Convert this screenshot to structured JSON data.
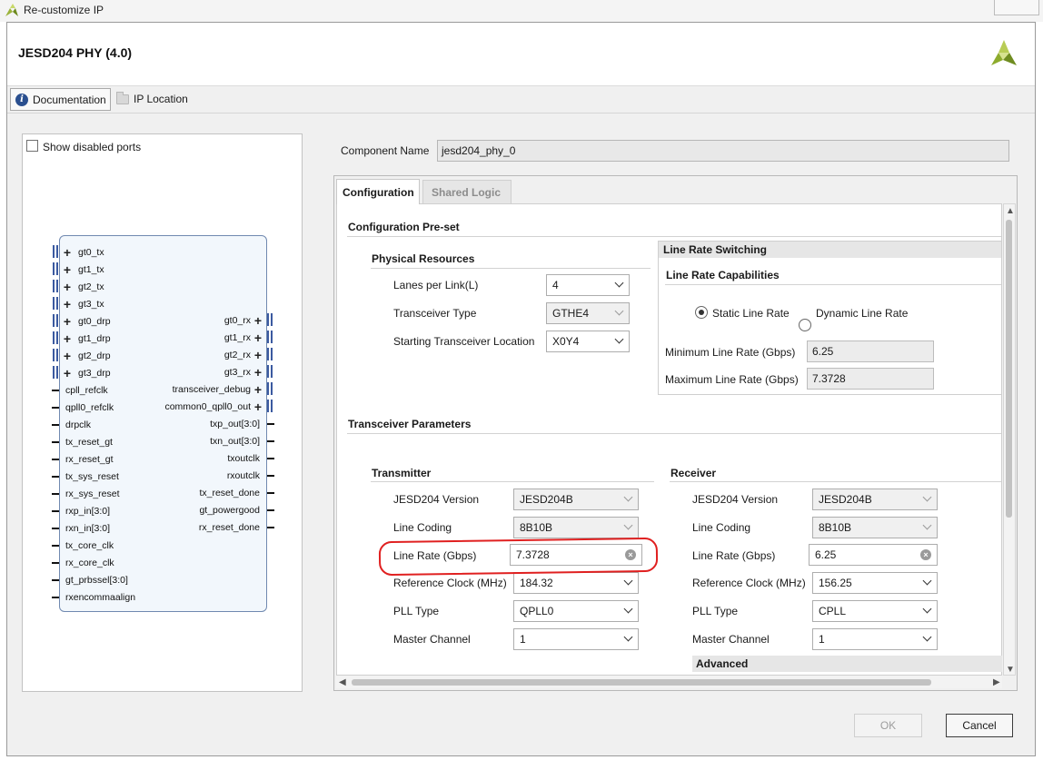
{
  "window": {
    "title": "Re-customize IP"
  },
  "header": {
    "title": "JESD204 PHY (4.0)"
  },
  "toolbar": {
    "documentation_label": "Documentation",
    "ip_location_label": "IP Location"
  },
  "symbol_panel": {
    "show_disabled_ports_label": "Show disabled ports",
    "left_ports": [
      "gt0_tx",
      "gt1_tx",
      "gt2_tx",
      "gt3_tx",
      "gt0_drp",
      "gt1_drp",
      "gt2_drp",
      "gt3_drp",
      "cpll_refclk",
      "qpll0_refclk",
      "drpclk",
      "tx_reset_gt",
      "rx_reset_gt",
      "tx_sys_reset",
      "rx_sys_reset",
      "rxp_in[3:0]",
      "rxn_in[3:0]",
      "tx_core_clk",
      "rx_core_clk",
      "gt_prbssel[3:0]",
      "rxencommaalign"
    ],
    "right_ports": [
      "gt0_rx",
      "gt1_rx",
      "gt2_rx",
      "gt3_rx",
      "transceiver_debug",
      "common0_qpll0_out",
      "txp_out[3:0]",
      "txn_out[3:0]",
      "txoutclk",
      "rxoutclk",
      "tx_reset_done",
      "gt_powergood",
      "rx_reset_done"
    ]
  },
  "component": {
    "label": "Component Name",
    "value": "jesd204_phy_0"
  },
  "tabs": [
    {
      "label": "Configuration"
    },
    {
      "label": "Shared Logic"
    }
  ],
  "config": {
    "preset_title": "Configuration Pre-set",
    "physical": {
      "title": "Physical Resources",
      "lanes_label": "Lanes per Link(L)",
      "lanes_value": "4",
      "transceiver_type_label": "Transceiver Type",
      "transceiver_type_value": "GTHE4",
      "start_loc_label": "Starting Transceiver Location",
      "start_loc_value": "X0Y4"
    },
    "line_rate_switching": {
      "title": "Line Rate Switching",
      "capabilities_title": "Line Rate Capabilities",
      "static_label": "Static Line Rate",
      "dynamic_label": "Dynamic Line Rate",
      "min_label": "Minimum Line Rate (Gbps)",
      "min_value": "6.25",
      "max_label": "Maximum Line Rate (Gbps)",
      "max_value": "7.3728"
    },
    "transceiver_params_title": "Transceiver Parameters",
    "transmitter": {
      "title": "Transmitter",
      "version_label": "JESD204 Version",
      "version_value": "JESD204B",
      "coding_label": "Line Coding",
      "coding_value": "8B10B",
      "rate_label": "Line Rate (Gbps)",
      "rate_value": "7.3728",
      "refclk_label": "Reference Clock (MHz)",
      "refclk_value": "184.32",
      "pll_label": "PLL Type",
      "pll_value": "QPLL0",
      "master_label": "Master Channel",
      "master_value": "1"
    },
    "receiver": {
      "title": "Receiver",
      "version_label": "JESD204 Version",
      "version_value": "JESD204B",
      "coding_label": "Line Coding",
      "coding_value": "8B10B",
      "rate_label": "Line Rate (Gbps)",
      "rate_value": "6.25",
      "refclk_label": "Reference Clock (MHz)",
      "refclk_value": "156.25",
      "pll_label": "PLL Type",
      "pll_value": "CPLL",
      "master_label": "Master Channel",
      "master_value": "1"
    },
    "advanced_title": "Advanced"
  },
  "buttons": {
    "ok_label": "OK",
    "cancel_label": "Cancel"
  },
  "colors": {
    "highlight": "#e02020",
    "brand_logo": "#8dab2c",
    "block_border": "#7089b0"
  }
}
